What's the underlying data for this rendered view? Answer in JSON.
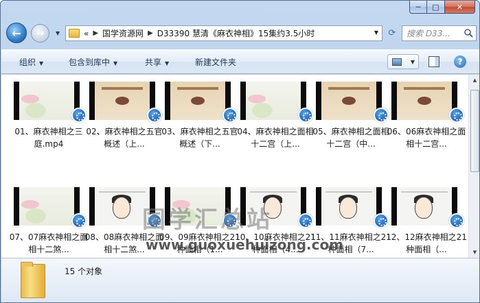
{
  "window": {
    "caption": {
      "minimize": "─",
      "maximize": "□",
      "close": "✕"
    }
  },
  "nav": {
    "breadcrumb": [
      "«",
      "国学资源网",
      "D33390 慧清《麻衣神相》15集约3.5小时"
    ],
    "search_placeholder": "搜索 D33..."
  },
  "toolbar": {
    "organize": "组织",
    "include_in_library": "包含到库中",
    "share": "共享",
    "new_folder": "新建文件夹"
  },
  "files": [
    {
      "label": "01、麻衣神相之三庭.mp4",
      "thumb": "lotus"
    },
    {
      "label": "02、麻衣神相之五官概述（上...",
      "thumb": "slide"
    },
    {
      "label": "03、麻衣神相之五官概述（下...",
      "thumb": "slide"
    },
    {
      "label": "04、麻衣神相之面相十二宫（上...",
      "thumb": "lotus"
    },
    {
      "label": "05、麻衣神相之面相十二宫（中...",
      "thumb": "slide"
    },
    {
      "label": "06、06麻衣神相之面相十二宫...",
      "thumb": "slide"
    },
    {
      "label": "07、07麻衣神相之面相十二煞...",
      "thumb": "lotus"
    },
    {
      "label": "08、08麻衣神相之面相十二煞...",
      "thumb": "face"
    },
    {
      "label": "09、09麻衣神相之21种面相（1...",
      "thumb": "lotus"
    },
    {
      "label": "10、10麻衣神相之21种面相（4...",
      "thumb": "face"
    },
    {
      "label": "11、11麻衣神相之21种面相（7...",
      "thumb": "face"
    },
    {
      "label": "12、12麻衣神相之21种面相（...",
      "thumb": "face"
    }
  ],
  "watermark": {
    "title": "国学汇总站",
    "url": "www.guoxuehuizong.com"
  },
  "details": {
    "count": "15 个对象"
  }
}
